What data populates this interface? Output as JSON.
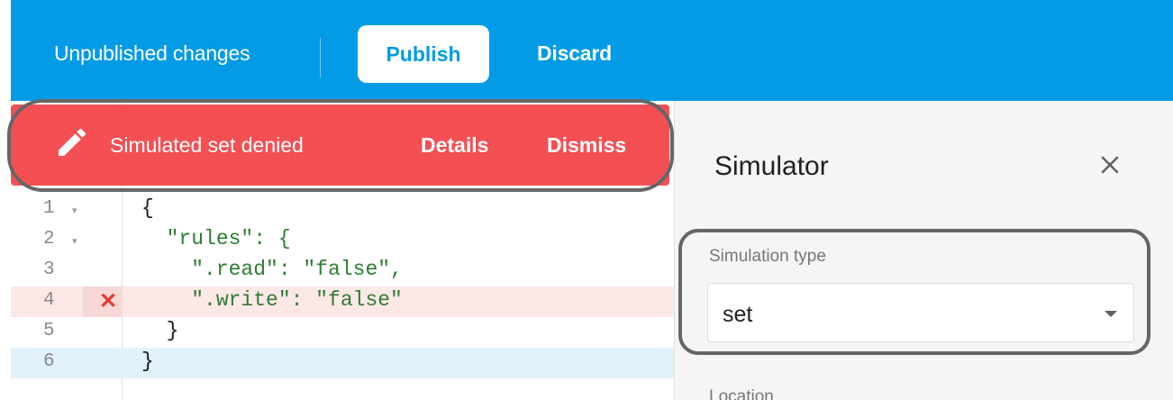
{
  "topbar": {
    "status": "Unpublished changes",
    "publish_label": "Publish",
    "discard_label": "Discard"
  },
  "banner": {
    "icon": "pencil-icon",
    "message": "Simulated set denied",
    "details_label": "Details",
    "dismiss_label": "Dismiss"
  },
  "editor": {
    "lines": [
      {
        "number": "1",
        "folded": true,
        "text": "{"
      },
      {
        "number": "2",
        "folded": true,
        "text": "  \"rules\": {"
      },
      {
        "number": "3",
        "folded": false,
        "text": "    \".read\": \"false\","
      },
      {
        "number": "4",
        "folded": false,
        "text": "    \".write\": \"false\"",
        "error": true,
        "error_icon": "close-x-icon"
      },
      {
        "number": "5",
        "folded": false,
        "text": "  }"
      },
      {
        "number": "6",
        "folded": false,
        "text": "}"
      }
    ]
  },
  "simulator": {
    "title": "Simulator",
    "close_icon": "close-icon",
    "type_label": "Simulation type",
    "type_value": "set",
    "location_label": "Location"
  },
  "colors": {
    "topbar": "#039be5",
    "banner": "#f45054",
    "error_line": "#fde8e8",
    "active_line": "#e1f2fb"
  }
}
